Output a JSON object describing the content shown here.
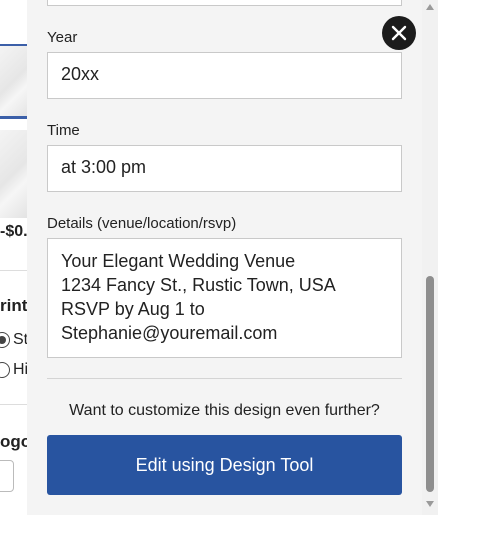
{
  "background_page": {
    "price_text": "-$0.",
    "print_heading": "rint",
    "radio_options": [
      "St",
      "Hi"
    ],
    "logo_heading": "ogo"
  },
  "form": {
    "year": {
      "label": "Year",
      "value": "20xx"
    },
    "time": {
      "label": "Time",
      "value": "at 3:00 pm"
    },
    "details": {
      "label": "Details (venue/location/rsvp)",
      "lines": [
        "Your Elegant Wedding Venue",
        "1234 Fancy St., Rustic Town, USA",
        "RSVP by Aug 1 to",
        "Stephanie@youremail.com"
      ]
    }
  },
  "customize_prompt": "Want to customize this design even further?",
  "design_tool_button": "Edit using Design Tool",
  "icons": {
    "close": "close-icon",
    "scroll_up": "chevron-up-icon",
    "scroll_down": "chevron-down-icon"
  },
  "colors": {
    "panel_bg": "#f4f4f4",
    "button_bg": "#2854a0",
    "close_bg": "#1c1c1c",
    "accent_blue": "#3b5fa8"
  }
}
